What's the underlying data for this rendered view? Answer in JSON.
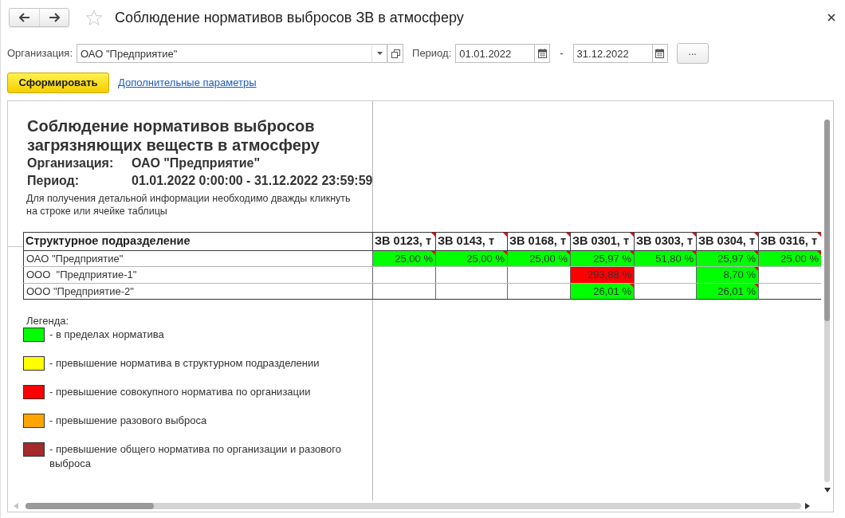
{
  "window": {
    "title": "Соблюдение нормативов выбросов ЗВ в атмосферу",
    "favorite": false
  },
  "filters": {
    "organization": {
      "label": "Организация:",
      "value": "ОАО \"Предприятие\""
    },
    "period": {
      "label": "Период:",
      "start": "01.01.2022",
      "separator": "-",
      "end": "31.12.2022",
      "more_button": "..."
    }
  },
  "actions": {
    "generate_button": "Сформировать",
    "extra_parameters_link": "Дополнительные параметры"
  },
  "report": {
    "title": "Соблюдение нормативов выбросов загрязняющих веществ в атмосферу",
    "details": [
      {
        "label": "Организация:",
        "value": "ОАО \"Предприятие\""
      },
      {
        "label": "Период:",
        "value": "01.01.2022 0:00:00 - 31.12.2022 23:59:59"
      }
    ],
    "hint": "Для получения детальной информации необходимо дважды кликнуть на строке или ячейке таблицы",
    "table": {
      "columns": [
        {
          "title": "Структурное подразделение",
          "note": false
        },
        {
          "title": "ЗВ 0123, т",
          "note": true
        },
        {
          "title": "ЗВ 0143, т",
          "note": true
        },
        {
          "title": "ЗВ 0168, т",
          "note": true
        },
        {
          "title": "ЗВ 0301, т",
          "note": true
        },
        {
          "title": "ЗВ 0303, т",
          "note": true
        },
        {
          "title": "ЗВ 0304, т",
          "note": true
        },
        {
          "title": "ЗВ 0316, т",
          "note": true
        }
      ],
      "rows": [
        {
          "cells": [
            "ОАО \"Предприятие\"",
            {
              "value": "25,00 %",
              "color": "#00ff00",
              "note": true
            },
            {
              "value": "25,00 %",
              "color": "#00ff00",
              "note": true
            },
            {
              "value": "25,00 %",
              "color": "#00ff00",
              "note": true
            },
            {
              "value": "25,97 %",
              "color": "#00ff00",
              "note": true
            },
            {
              "value": "51,80 %",
              "color": "#00ff00",
              "note": true
            },
            {
              "value": "25,97 %",
              "color": "#00ff00",
              "note": true
            },
            {
              "value": "25,00 %",
              "color": "#00ff00",
              "note": true
            }
          ]
        },
        {
          "cells": [
            "ООО  \"Предприятие-1\"",
            "",
            "",
            "",
            {
              "value": "293,88 %",
              "color": "#ff0000",
              "note": false
            },
            "",
            {
              "value": "8,70 %",
              "color": "#00ff00",
              "note": true
            },
            ""
          ]
        },
        {
          "cells": [
            "ООО \"Предприятие-2\"",
            "",
            "",
            "",
            {
              "value": "26,01 %",
              "color": "#00ff00",
              "note": true
            },
            "",
            {
              "value": "26,01 %",
              "color": "#00ff00",
              "note": true
            },
            ""
          ]
        }
      ]
    },
    "legend": {
      "title": "Легенда:",
      "items": [
        {
          "color": "#00ff00",
          "text": "- в пределах норматива"
        },
        {
          "color": "#ffff00",
          "text": "- превышение норматива в структурном подразделении"
        },
        {
          "color": "#ff0000",
          "text": "- превышение совокупного норматива по организации"
        },
        {
          "color": "#ffa500",
          "text": "- превышение разового выброса"
        },
        {
          "color": "#a52a2a",
          "text": "- превышение общего норматива по организации и разового выброса"
        }
      ]
    }
  }
}
